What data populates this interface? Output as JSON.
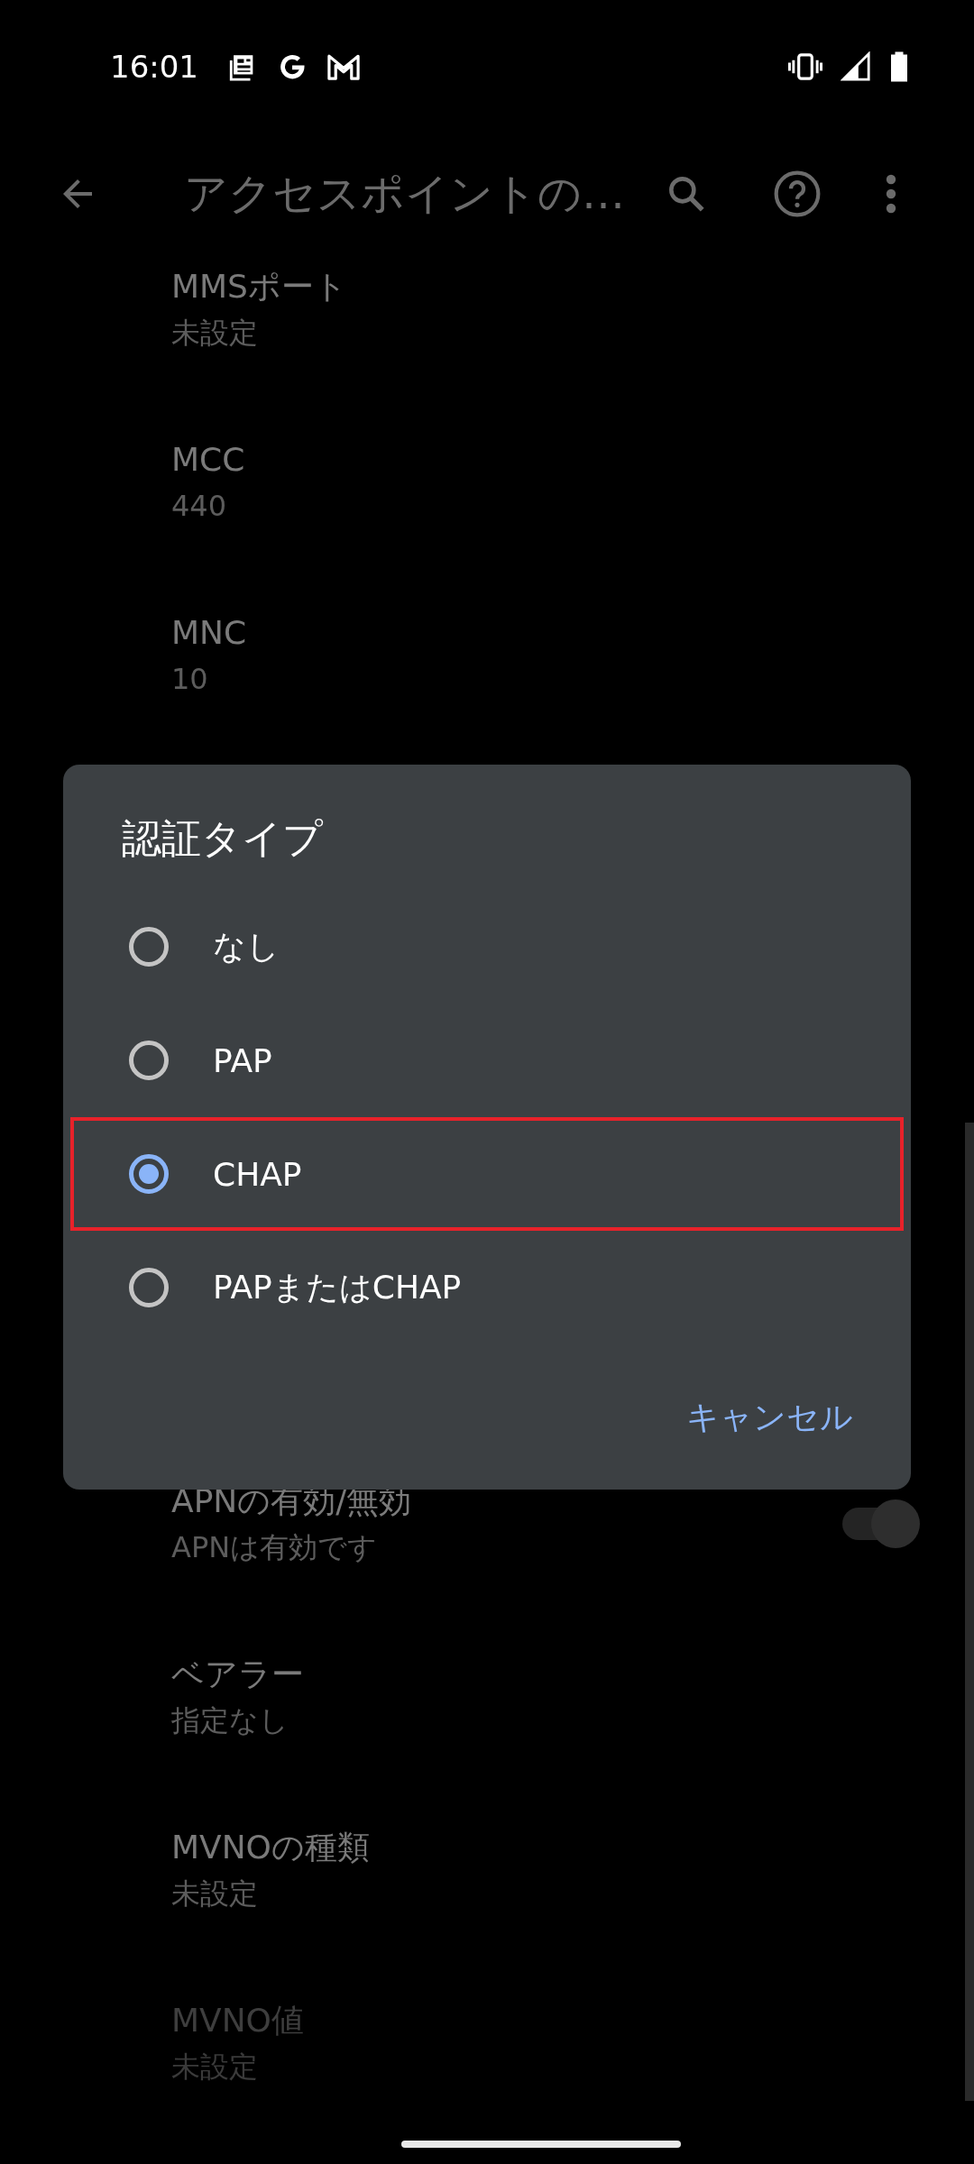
{
  "status_bar": {
    "time": "16:01"
  },
  "app_bar": {
    "title": "アクセスポイントの…"
  },
  "settings_top": [
    {
      "title": "MMSポート",
      "summary": "未設定",
      "disabled": false
    },
    {
      "title": "MCC",
      "summary": "440",
      "disabled": false
    },
    {
      "title": "MNC",
      "summary": "10",
      "disabled": false
    }
  ],
  "settings_bottom": [
    {
      "kind": "switch",
      "title": "APNの有効/無効",
      "summary": "APNは有効です",
      "disabled": false,
      "on": true
    },
    {
      "kind": "text",
      "title": "ベアラー",
      "summary": "指定なし",
      "disabled": false
    },
    {
      "kind": "text",
      "title": "MVNOの種類",
      "summary": "未設定",
      "disabled": false
    },
    {
      "kind": "text",
      "title": "MVNO値",
      "summary": "未設定",
      "disabled": true
    }
  ],
  "dialog": {
    "title": "認証タイプ",
    "options": [
      {
        "label": "なし",
        "selected": false,
        "highlighted": false
      },
      {
        "label": "PAP",
        "selected": false,
        "highlighted": false
      },
      {
        "label": "CHAP",
        "selected": true,
        "highlighted": true
      },
      {
        "label": "PAPまたはCHAP",
        "selected": false,
        "highlighted": false
      }
    ],
    "cancel": "キャンセル"
  }
}
